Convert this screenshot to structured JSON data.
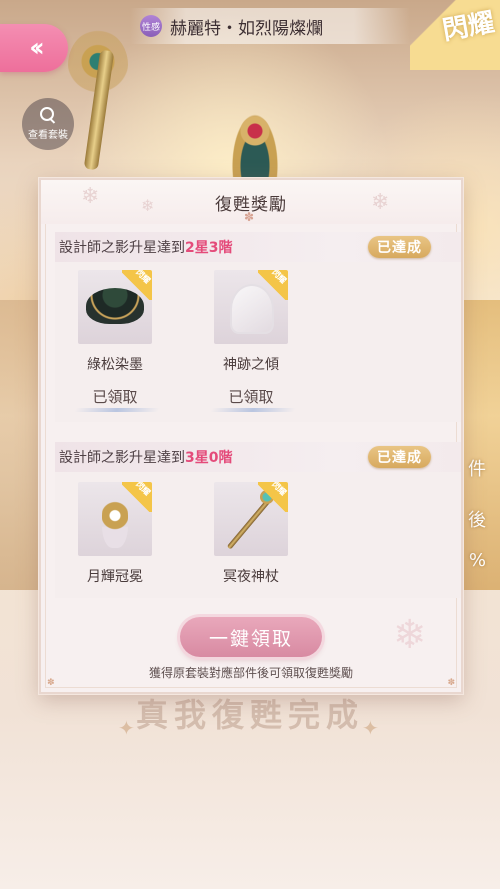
{
  "header": {
    "tag_label": "性感",
    "suit_name": "赫麗特・如烈陽燦爛",
    "rarity_label": "閃耀",
    "view_suit_label": "查看套裝"
  },
  "background": {
    "slogan": "真我復甦完成",
    "side_texts": [
      "件",
      "後",
      "%"
    ]
  },
  "modal": {
    "title": "復甦獎勵",
    "sections": [
      {
        "condition_prefix": "設計師之影升星達到",
        "condition_highlight": "2星3階",
        "status": "已達成",
        "items": [
          {
            "name": "綠松染墨",
            "tag": "閃耀",
            "state": "已領取",
            "icon": "skirt-icon"
          },
          {
            "name": "神跡之傾",
            "tag": "閃耀",
            "state": "已領取",
            "icon": "wings-icon"
          }
        ]
      },
      {
        "condition_prefix": "設計師之影升星達到",
        "condition_highlight": "3星0階",
        "status": "已達成",
        "items": [
          {
            "name": "月輝冠冕",
            "tag": "閃耀",
            "icon": "crown-icon"
          },
          {
            "name": "冥夜神杖",
            "tag": "閃耀",
            "icon": "staff-icon"
          }
        ]
      }
    ],
    "claim_all_label": "一鍵領取",
    "hint": "獲得原套裝對應部件後可領取復甦獎勵"
  },
  "colors": {
    "accent_pink": "#e44b7a",
    "back_button": "#ee6f9b",
    "achieved_badge": "#d7a95e",
    "claim_button": "#d88aa2"
  }
}
